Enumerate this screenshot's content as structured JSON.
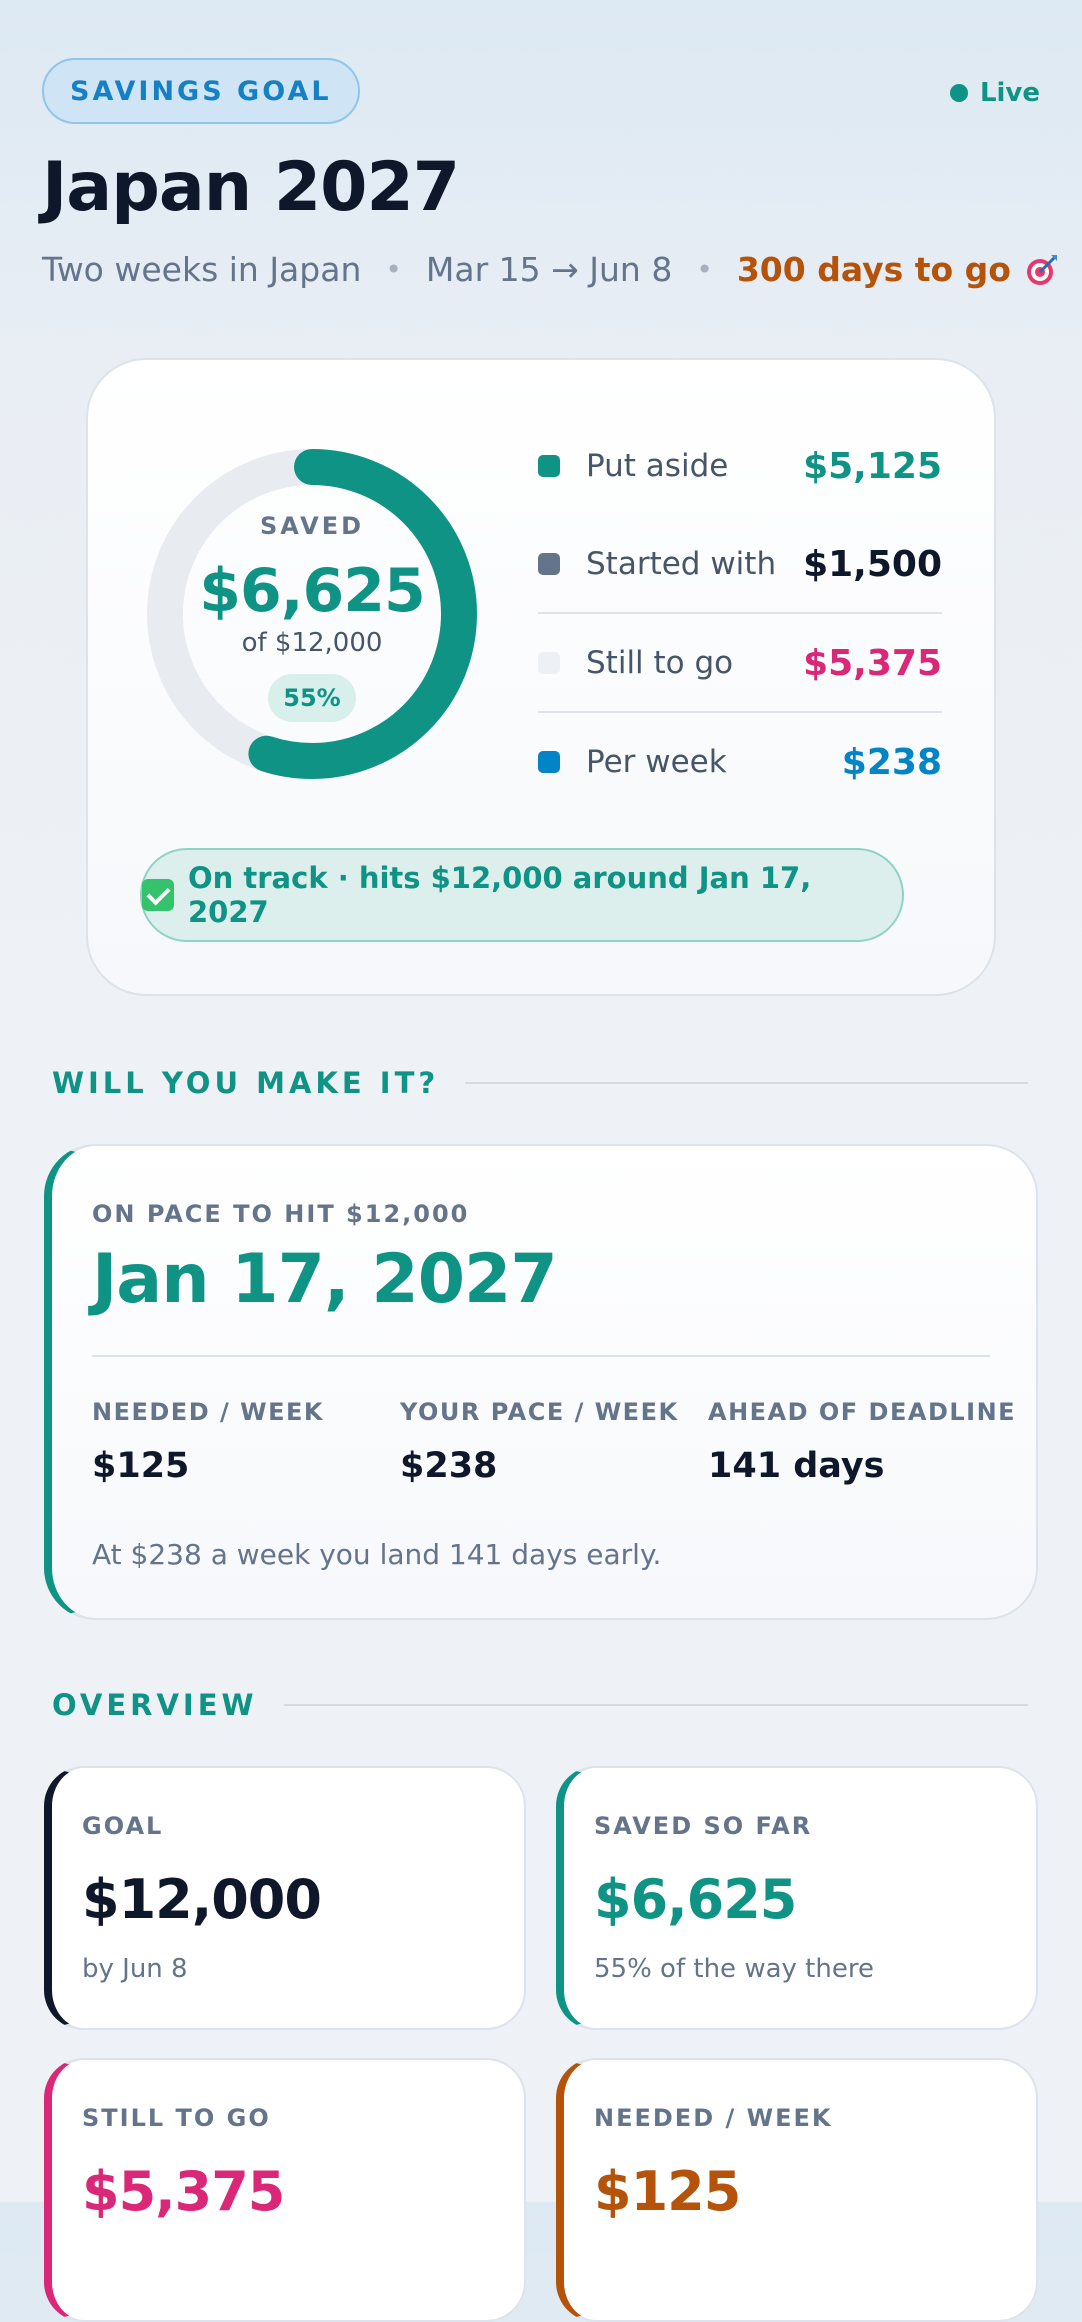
{
  "header": {
    "badge": "SAVINGS GOAL",
    "live_label": "Live",
    "title": "Japan 2027",
    "subtitle_trip": "Two weeks in Japan",
    "subtitle_sep": "•",
    "subtitle_dates": "Mar 15 → Jun 8",
    "subtitle_countdown": "300 days to go",
    "countdown_icon": "target-icon"
  },
  "progress_card": {
    "ring_label": "SAVED",
    "saved": "$6,625",
    "of_goal": "of $12,000",
    "percent_label": "55%",
    "percent_value": 0.55,
    "legend": [
      {
        "label": "Put aside",
        "value": "$5,125",
        "color": "#0e9384"
      },
      {
        "label": "Started with",
        "value": "$1,500",
        "color": "#64748b"
      },
      {
        "label": "Still to go",
        "value": "$5,375",
        "color": "#db2777"
      },
      {
        "label": "Per week",
        "value": "$238",
        "color": "#0284c7"
      }
    ],
    "status": "On track · hits $12,000 around Jan 17, 2027"
  },
  "section_pace": {
    "title": "WILL YOU MAKE IT?"
  },
  "pace_card": {
    "label": "ON PACE TO HIT $12,000",
    "date": "Jan 17, 2027",
    "stats": [
      {
        "label": "NEEDED / WEEK",
        "value": "$125"
      },
      {
        "label": "YOUR PACE / WEEK",
        "value": "$238"
      },
      {
        "label": "AHEAD OF DEADLINE",
        "value": "141 days"
      }
    ],
    "note": "At $238 a week you land 141 days early."
  },
  "section_overview": {
    "title": "OVERVIEW"
  },
  "overview": [
    {
      "label": "GOAL",
      "value": "$12,000",
      "sub": "by Jun 8",
      "color": "#0f172a"
    },
    {
      "label": "SAVED SO FAR",
      "value": "$6,625",
      "sub": "55% of the way there",
      "color": "#0e9384"
    },
    {
      "label": "STILL TO GO",
      "value": "$5,375",
      "sub": "",
      "color": "#db2777"
    },
    {
      "label": "NEEDED / WEEK",
      "value": "$125",
      "sub": "",
      "color": "#b45309"
    }
  ],
  "colors": {
    "accent": "#0e9384",
    "ring_track": "#e8ecf1",
    "badge": "#1580c4",
    "countdown": "#b45309"
  }
}
